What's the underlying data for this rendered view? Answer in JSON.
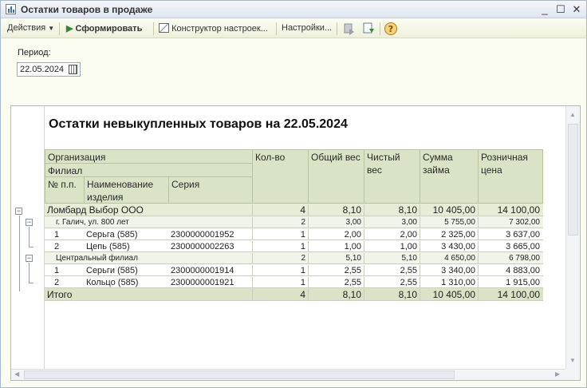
{
  "window": {
    "title": "Остатки товаров в продаже"
  },
  "toolbar": {
    "actions": "Действия",
    "generate": "Сформировать",
    "constructor": "Конструктор настроек...",
    "settings": "Настройки..."
  },
  "period": {
    "label": "Период:",
    "value": "22.05.2024"
  },
  "report": {
    "title": "Остатки невыкупленных товаров на 22.05.2024",
    "headers": {
      "org": "Организация",
      "branch": "Филиал",
      "num": "№ п.п.",
      "name": "Наименование изделия",
      "series": "Серия",
      "qty": "Кол-во",
      "gross": "Общий вес",
      "net": "Чистый вес",
      "loan": "Сумма займа",
      "retail": "Розничная цена"
    },
    "org_row": {
      "label": "Ломбард Выбор ООО",
      "qty": "4",
      "gross": "8,10",
      "net": "8,10",
      "loan": "10 405,00",
      "retail": "14 100,00"
    },
    "branches": [
      {
        "label": "г. Галич, ул. 800 лет",
        "qty": "2",
        "gross": "3,00",
        "net": "3,00",
        "loan": "5 755,00",
        "retail": "7 302,00",
        "items": [
          {
            "n": "1",
            "name": "Серьга (585)",
            "series": "2300000001952",
            "qty": "1",
            "gross": "2,00",
            "net": "2,00",
            "loan": "2 325,00",
            "retail": "3 637,00"
          },
          {
            "n": "2",
            "name": "Цепь (585)",
            "series": "2300000002263",
            "qty": "1",
            "gross": "1,00",
            "net": "1,00",
            "loan": "3 430,00",
            "retail": "3 665,00"
          }
        ]
      },
      {
        "label": "Центральный филиал",
        "qty": "2",
        "gross": "5,10",
        "net": "5,10",
        "loan": "4 650,00",
        "retail": "6 798,00",
        "items": [
          {
            "n": "1",
            "name": "Серьги (585)",
            "series": "2300000001914",
            "qty": "1",
            "gross": "2,55",
            "net": "2,55",
            "loan": "3 340,00",
            "retail": "4 883,00"
          },
          {
            "n": "2",
            "name": "Кольцо (585)",
            "series": "2300000001921",
            "qty": "1",
            "gross": "2,55",
            "net": "2,55",
            "loan": "1 310,00",
            "retail": "1 915,00"
          }
        ]
      }
    ],
    "total": {
      "label": "Итого",
      "qty": "4",
      "gross": "8,10",
      "net": "8,10",
      "loan": "10 405,00",
      "retail": "14 100,00"
    }
  },
  "colors": {
    "header_bg": "#d9e3c6",
    "group_bg": "#e6ecd6",
    "accent_green": "#2e8b2e"
  }
}
